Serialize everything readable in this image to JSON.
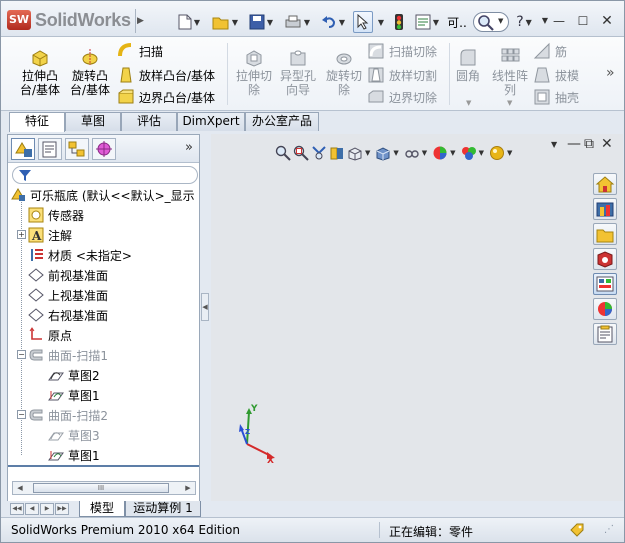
{
  "app": {
    "brand": "SolidWorks",
    "logo_badge": "SW",
    "title_truncated": "可.."
  },
  "title_icons": [
    "new-document-icon",
    "open-folder-icon",
    "save-icon",
    "print-icon",
    "undo-icon",
    "select-cursor-icon",
    "rebuild-traffic-light-icon",
    "file-properties-icon",
    "options-icon",
    "search-icon",
    "help-icon"
  ],
  "ribbon": {
    "features": {
      "extrude_boss": "拉伸凸\n台/基体",
      "revolve_boss": "旋转凸\n台/基体",
      "sweep": "扫描",
      "loft_boss": "放样凸台/基体",
      "boundary_boss": "边界凸台/基体",
      "extrude_cut": "拉伸切\n除",
      "hole_wizard": "异型孔\n向导",
      "revolve_cut": "旋转切\n除",
      "swept_cut": "扫描切除",
      "lofted_cut": "放样切割",
      "boundary_cut": "边界切除",
      "fillet": "圆角",
      "linear_pattern": "线性阵\n列",
      "rib": "筋",
      "draft": "拔模",
      "shell": "抽壳"
    }
  },
  "command_tabs": [
    "特征",
    "草图",
    "评估",
    "DimXpert",
    "办公室产品"
  ],
  "feature_manager": {
    "tab_icons": [
      "feature-manager-tree-icon",
      "property-manager-icon",
      "configuration-manager-icon",
      "dimxpert-manager-icon"
    ],
    "more": "»",
    "tree": [
      {
        "label": "可乐瓶底  (默认<<默认>_显示",
        "icon": "part-icon",
        "gray": false
      },
      {
        "label": "传感器",
        "icon": "sensors-icon",
        "gray": false
      },
      {
        "label": "注解",
        "icon": "annotations-icon",
        "gray": false
      },
      {
        "label": "材质 <未指定>",
        "icon": "material-icon",
        "gray": false
      },
      {
        "label": "前视基准面",
        "icon": "plane-icon",
        "gray": false
      },
      {
        "label": "上视基准面",
        "icon": "plane-icon",
        "gray": false
      },
      {
        "label": "右视基准面",
        "icon": "plane-icon",
        "gray": false
      },
      {
        "label": "原点",
        "icon": "origin-icon",
        "gray": false
      },
      {
        "label": "曲面-扫描1",
        "icon": "surface-sweep-icon",
        "gray": true
      },
      {
        "label": "草图2",
        "icon": "sketch-icon",
        "gray": false
      },
      {
        "label": "草图1",
        "icon": "sketch-icon",
        "gray": false
      },
      {
        "label": "曲面-扫描2",
        "icon": "surface-sweep-icon",
        "gray": true
      },
      {
        "label": "草图3",
        "icon": "sketch-icon",
        "gray": true
      },
      {
        "label": "草图1",
        "icon": "sketch-icon",
        "gray": false
      }
    ],
    "scroll_thumb": "III"
  },
  "bottom_tabs": [
    "模型",
    "运动算例 1"
  ],
  "status": {
    "edition": "SolidWorks Premium 2010 x64 Edition",
    "editing": "正在编辑：零件"
  },
  "axes": {
    "x": "X",
    "y": "Y",
    "z": "Z"
  },
  "colors": {
    "brand_red": "#c0392b",
    "accent_blue": "#3d6ea8",
    "axis_x": "#d42a2a",
    "axis_y": "#2f9a2f",
    "axis_z": "#2a4fd4"
  }
}
